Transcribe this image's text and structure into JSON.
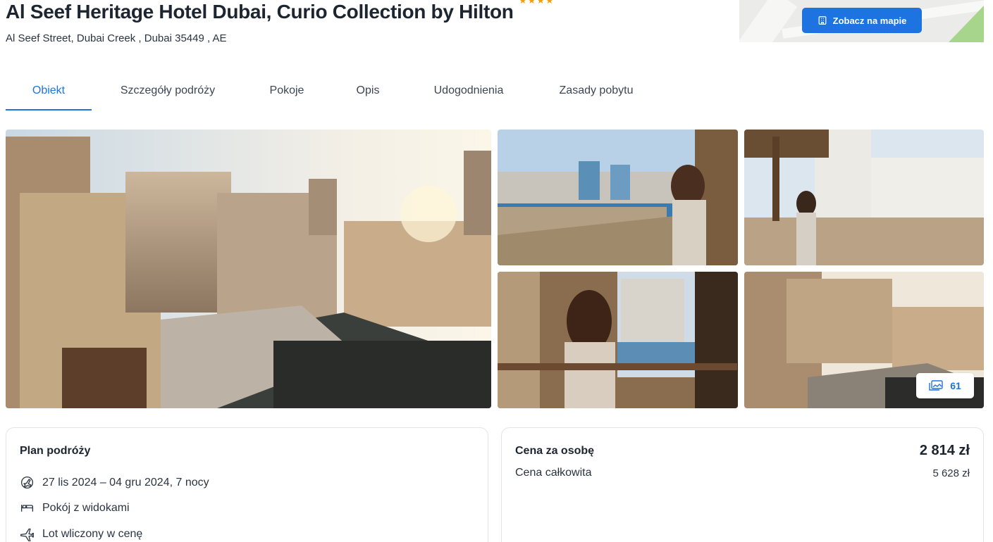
{
  "hotel": {
    "name": "Al Seef Heritage Hotel Dubai, Curio Collection by Hilton",
    "stars": 4,
    "address": "Al Seef Street, Dubai Creek , Dubai 35449 , AE"
  },
  "map": {
    "button_label": "Zobacz na mapie",
    "icon": "building-icon"
  },
  "tabs": [
    {
      "label": "Obiekt",
      "active": true
    },
    {
      "label": "Szczegóły podróży",
      "active": false
    },
    {
      "label": "Pokoje",
      "active": false
    },
    {
      "label": "Opis",
      "active": false
    },
    {
      "label": "Udogodnienia",
      "active": false
    },
    {
      "label": "Zasady pobytu",
      "active": false
    }
  ],
  "gallery": {
    "photo_count": "61",
    "photos": [
      "main-heritage-courtyard",
      "creek-view-woman",
      "white-building-woman",
      "window-view-woman",
      "heritage-courtyard-small"
    ]
  },
  "plan": {
    "title": "Plan podróży",
    "dates": "27 lis 2024 – 04 gru 2024, 7 nocy",
    "room": "Pokój z widokami",
    "flight": "Lot wliczony w cenę"
  },
  "price": {
    "per_person_label": "Cena za osobę",
    "per_person_value": "2 814 zł",
    "total_label": "Cena całkowita",
    "total_value": "5 628 zł"
  },
  "colors": {
    "accent": "#1d74e0",
    "star": "#f59e0b",
    "text": "#1c2530"
  }
}
